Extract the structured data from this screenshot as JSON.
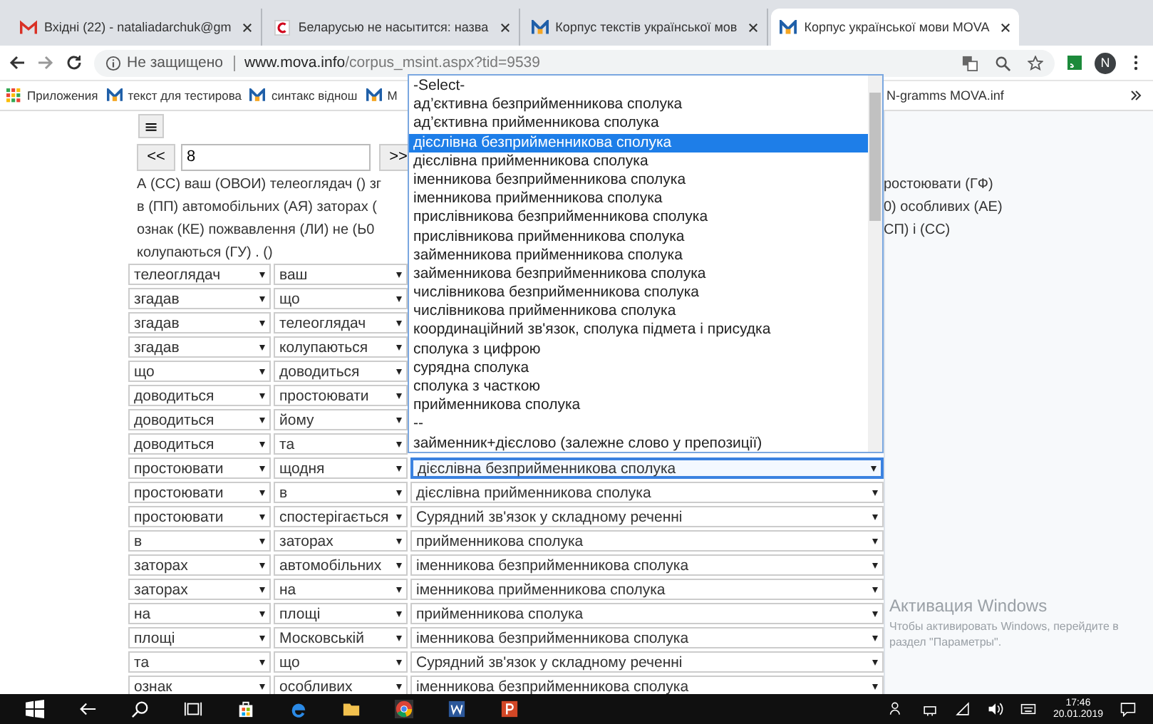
{
  "tabs": [
    {
      "title": "Вхідні (22) - nataliadarchuk@gm",
      "kind": "gmail",
      "selected": false
    },
    {
      "title": "Беларусью не насытится: назва",
      "kind": "c",
      "selected": false
    },
    {
      "title": "Корпус текстів української мов",
      "kind": "mova",
      "selected": false
    },
    {
      "title": "Корпус української мови MOVA",
      "kind": "mova",
      "selected": true
    }
  ],
  "address": {
    "security": "Не защищено",
    "domain": "www.mova.info",
    "path": "/corpus_msint.aspx?tid=9539",
    "avatar": "N"
  },
  "bookmarks": [
    {
      "label": "Приложения",
      "kind": "apps"
    },
    {
      "label": "текст для тестирова",
      "kind": "mova"
    },
    {
      "label": "синтакс віднош",
      "kind": "mova"
    },
    {
      "label": "М",
      "kind": "mova"
    }
  ],
  "bookmarks_right": [
    {
      "label": "N-gramms MOVA.inf"
    }
  ],
  "menu_button": "≡",
  "nav": {
    "prev": "<<",
    "page": "8",
    "next": ">>"
  },
  "text_lines": [
    {
      "left": "А (СС) ваш (ОВОИ) телеоглядач () зг",
      "right": "ростоювати (ГФ)"
    },
    {
      "left": "в (ПП) автомобільних (АЯ) заторах (",
      "right": "0) особливих (АЕ)"
    },
    {
      "left": "ознак (КЕ) пожвавлення (ЛИ) не (Ь0",
      "right": "СП) і (СС)"
    },
    {
      "left": "колупаються (ГУ) . ()"
    }
  ],
  "rows": [
    {
      "head": "телеоглядач",
      "dependent": "ваш"
    },
    {
      "head": "згадав",
      "dependent": "що"
    },
    {
      "head": "згадав",
      "dependent": "телеоглядач"
    },
    {
      "head": "згадав",
      "dependent": "колупаються"
    },
    {
      "head": "що",
      "dependent": "доводиться"
    },
    {
      "head": "доводиться",
      "dependent": "простоювати"
    },
    {
      "head": "доводиться",
      "dependent": "йому"
    },
    {
      "head": "доводиться",
      "dependent": "та"
    },
    {
      "head": "простоювати",
      "dependent": "щодня",
      "relation": {
        "label": "дієслівна безприйменникова сполука",
        "focused": true
      }
    },
    {
      "head": "простоювати",
      "dependent": "в",
      "relation": {
        "label": "дієслівна прийменникова сполука",
        "focused": false
      }
    },
    {
      "head": "простоювати",
      "dependent": "спостерігається",
      "relation": {
        "label": "Сурядний зв'язок у складному реченні",
        "focused": false
      }
    },
    {
      "head": "в",
      "dependent": "заторах",
      "relation": {
        "label": "прийменникова сполука",
        "focused": false
      }
    },
    {
      "head": "заторах",
      "dependent": "автомобільних",
      "relation": {
        "label": "іменникова безприйменникова сполука",
        "focused": false
      }
    },
    {
      "head": "заторах",
      "dependent": "на",
      "relation": {
        "label": "іменникова прийменникова сполука",
        "focused": false
      }
    },
    {
      "head": "на",
      "dependent": "площі",
      "relation": {
        "label": "прийменникова сполука",
        "focused": false
      }
    },
    {
      "head": "площі",
      "dependent": "Московській",
      "relation": {
        "label": "іменникова безприйменникова сполука",
        "focused": false
      }
    },
    {
      "head": "та",
      "dependent": "що",
      "relation": {
        "label": "Сурядний зв'язок у складному реченні",
        "focused": false
      }
    },
    {
      "head": "ознак",
      "dependent": "особливих",
      "relation": {
        "label": "іменникова безприйменникова сполука",
        "focused": false
      }
    }
  ],
  "dropdown_options": [
    {
      "label": "-Select-",
      "selected": false
    },
    {
      "label": "ад’єктивна безприйменникова сполука",
      "selected": false
    },
    {
      "label": "ад’єктивна прийменникова сполука",
      "selected": false
    },
    {
      "label": "дієслівна безприйменникова сполука",
      "selected": true
    },
    {
      "label": "дієслівна прийменникова сполука",
      "selected": false
    },
    {
      "label": "іменникова безприйменникова сполука",
      "selected": false
    },
    {
      "label": "іменникова прийменникова сполука",
      "selected": false
    },
    {
      "label": "прислівникова безприйменникова сполука",
      "selected": false
    },
    {
      "label": "прислівникова прийменникова сполука",
      "selected": false
    },
    {
      "label": "займенникова прийменникова сполука",
      "selected": false
    },
    {
      "label": "займенникова безприйменникова сполука",
      "selected": false
    },
    {
      "label": "числівникова безприйменникова сполука",
      "selected": false
    },
    {
      "label": "числівникова прийменникова сполука",
      "selected": false
    },
    {
      "label": "координаційний зв'язок, сполука підмета і присудка",
      "selected": false
    },
    {
      "label": "сполука з цифрою",
      "selected": false
    },
    {
      "label": "сурядна сполука",
      "selected": false
    },
    {
      "label": "сполука з часткою",
      "selected": false
    },
    {
      "label": "прийменникова сполука",
      "selected": false
    },
    {
      "label": "--",
      "selected": false
    },
    {
      "label": "займенник+дієслово (залежне слово у препозиції)",
      "selected": false
    }
  ],
  "activation": {
    "title": "Активация Windows",
    "text": "Чтобы активировать Windows, перейдите в раздел \"Параметры\"."
  },
  "taskbar": {
    "time": "17:46",
    "date": "20.01.2019"
  }
}
